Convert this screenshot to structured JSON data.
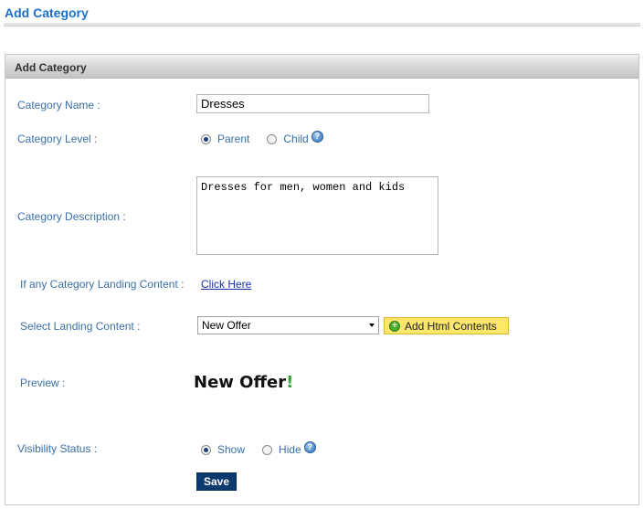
{
  "page": {
    "title": "Add Category"
  },
  "panel": {
    "header": "Add Category"
  },
  "form": {
    "category_name": {
      "label": "Category Name :",
      "value": "Dresses"
    },
    "category_level": {
      "label": "Category Level :",
      "options": [
        "Parent",
        "Child"
      ],
      "selected": "Parent"
    },
    "category_description": {
      "label": "Category Description :",
      "value": "Dresses for men, women and kids"
    },
    "landing_content": {
      "label": "If any Category Landing Content :",
      "link_text": "Click Here"
    },
    "select_landing": {
      "label": "Select Landing Content :",
      "selected": "New Offer",
      "add_button": "Add Html Contents"
    },
    "preview": {
      "label": "Preview :",
      "text": "New Offer",
      "accent": "!"
    },
    "visibility": {
      "label": "Visibility Status :",
      "options": [
        "Show",
        "Hide"
      ],
      "selected": "Show"
    },
    "save_label": "Save"
  },
  "icons": {
    "help": "help-question-icon",
    "add": "plus-circle-icon",
    "dropdown": "chevron-down-icon"
  },
  "colors": {
    "title": "#1f6fc5",
    "label": "#3a6fa8",
    "save_button": "#0d3a6e",
    "add_button": "#fde76a"
  }
}
